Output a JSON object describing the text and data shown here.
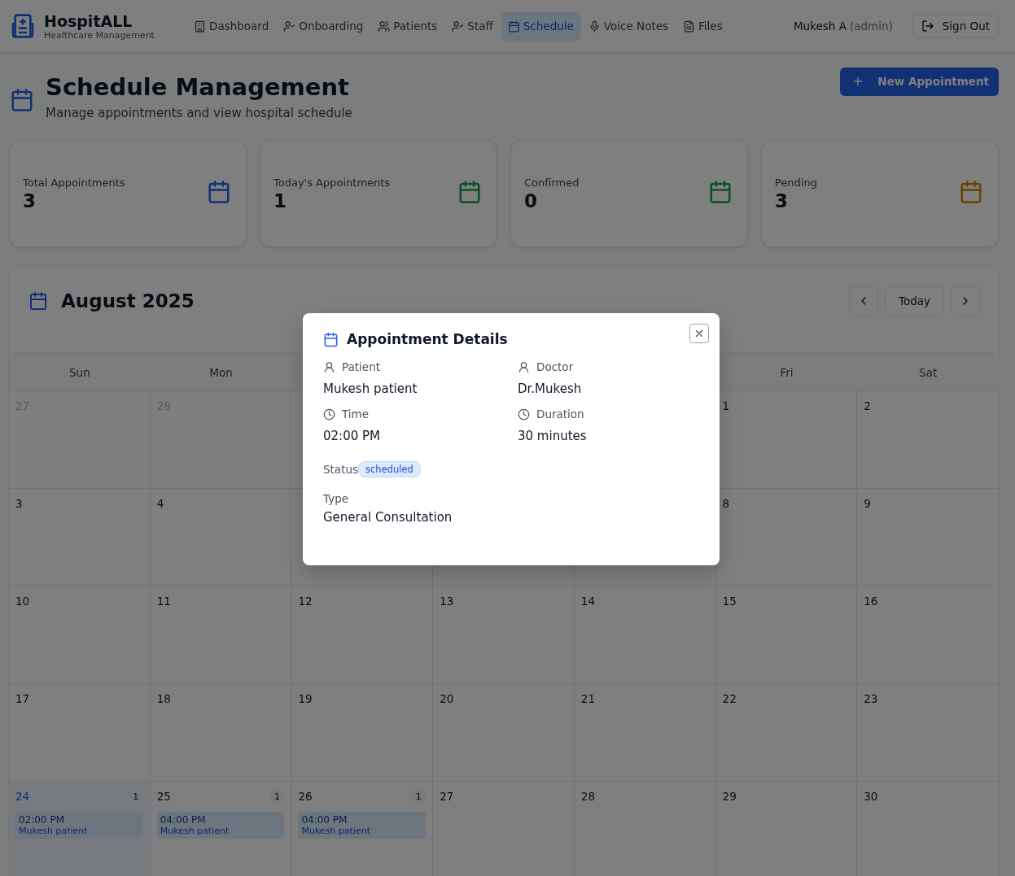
{
  "header": {
    "brand": "HospitALL",
    "tagline": "Healthcare Management",
    "nav": [
      {
        "label": "Dashboard",
        "selected": false
      },
      {
        "label": "Onboarding",
        "selected": false
      },
      {
        "label": "Patients",
        "selected": false
      },
      {
        "label": "Staff",
        "selected": false
      },
      {
        "label": "Schedule",
        "selected": true
      },
      {
        "label": "Voice Notes",
        "selected": false
      },
      {
        "label": "Files",
        "selected": false
      }
    ],
    "user": {
      "name": "Mukesh A",
      "role": "(admin)"
    },
    "sign_out": "Sign Out"
  },
  "page": {
    "title": "Schedule Management",
    "subtitle": "Manage appointments and view hospital schedule",
    "new_button": "New Appointment"
  },
  "stats": [
    {
      "label": "Total Appointments",
      "value": "3",
      "kind": "total"
    },
    {
      "label": "Today's Appointments",
      "value": "1",
      "kind": "today"
    },
    {
      "label": "Confirmed",
      "value": "0",
      "kind": "confirmed"
    },
    {
      "label": "Pending",
      "value": "3",
      "kind": "pending"
    }
  ],
  "calendar": {
    "title": "August 2025",
    "today_button": "Today",
    "weekdays": [
      "Sun",
      "Mon",
      "Fri",
      "Sat"
    ],
    "weeks": [
      [
        {
          "day": "27",
          "muted": true,
          "today": false
        },
        {
          "day": "28",
          "muted": true,
          "today": false
        },
        {
          "day": "1",
          "muted": false,
          "today": false
        },
        {
          "day": "2",
          "muted": false,
          "today": false
        }
      ],
      [
        {
          "day": "3",
          "muted": false,
          "today": false
        },
        {
          "day": "4",
          "muted": false,
          "today": false
        },
        {
          "day": "8",
          "muted": false,
          "today": false
        },
        {
          "day": "9",
          "muted": false,
          "today": false
        }
      ],
      [
        {
          "day": "10",
          "muted": false,
          "today": false
        },
        {
          "day": "11",
          "muted": false,
          "today": false
        },
        {
          "day": "12",
          "muted": false,
          "today": false
        },
        {
          "day": "13",
          "muted": false,
          "today": false
        },
        {
          "day": "14",
          "muted": false,
          "today": false
        },
        {
          "day": "15",
          "muted": false,
          "today": false
        },
        {
          "day": "16",
          "muted": false,
          "today": false
        }
      ],
      [
        {
          "day": "17",
          "muted": false,
          "today": false
        },
        {
          "day": "18",
          "muted": false,
          "today": false
        },
        {
          "day": "19",
          "muted": false,
          "today": false
        },
        {
          "day": "20",
          "muted": false,
          "today": false
        },
        {
          "day": "21",
          "muted": false,
          "today": false
        },
        {
          "day": "22",
          "muted": false,
          "today": false
        },
        {
          "day": "23",
          "muted": false,
          "today": false
        }
      ],
      [
        {
          "day": "24",
          "muted": false,
          "today": true,
          "count": "1",
          "events": [
            {
              "time": "02:00 PM",
              "patient": "Mukesh patient"
            }
          ]
        },
        {
          "day": "25",
          "muted": false,
          "today": false,
          "count": "1",
          "events": [
            {
              "time": "04:00 PM",
              "patient": "Mukesh patient"
            }
          ]
        },
        {
          "day": "26",
          "muted": false,
          "today": false,
          "count": "1",
          "events": [
            {
              "time": "04:00 PM",
              "patient": "Mukesh patient"
            }
          ]
        },
        {
          "day": "27",
          "muted": false,
          "today": false
        },
        {
          "day": "28",
          "muted": false,
          "today": false
        },
        {
          "day": "29",
          "muted": false,
          "today": false
        },
        {
          "day": "30",
          "muted": false,
          "today": false
        }
      ]
    ]
  },
  "modal": {
    "title": "Appointment Details",
    "fields": [
      {
        "label": "Patient",
        "value": "Mukesh patient"
      },
      {
        "label": "Doctor",
        "value": "Dr.Mukesh"
      },
      {
        "label": "Time",
        "value": "02:00 PM"
      },
      {
        "label": "Duration",
        "value": "30 minutes"
      }
    ],
    "status": {
      "label": "Status",
      "value": "scheduled"
    },
    "type": {
      "label": "Type",
      "value": "General Consultation"
    }
  }
}
